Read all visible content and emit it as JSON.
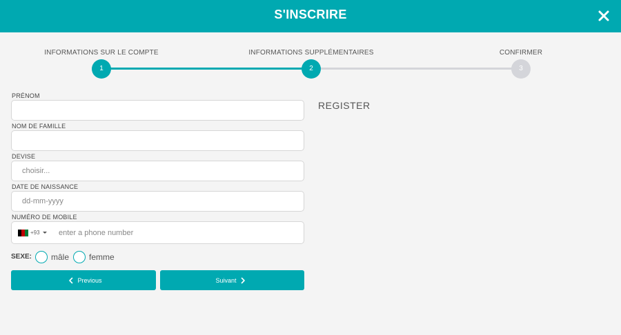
{
  "header": {
    "title": "S'INSCRIRE",
    "close_icon": "close-icon"
  },
  "stepper": {
    "steps": [
      {
        "label": "INFORMATIONS SUR LE COMPTE",
        "number": "1",
        "state": "active"
      },
      {
        "label": "INFORMATIONS SUPPLÉMENTAIRES",
        "number": "2",
        "state": "active"
      },
      {
        "label": "CONFIRMER",
        "number": "3",
        "state": "inactive"
      }
    ]
  },
  "form": {
    "prenom": {
      "label": "PRÉNOM",
      "value": "",
      "placeholder": ""
    },
    "nom": {
      "label": "NOM DE FAMILLE",
      "value": "",
      "placeholder": ""
    },
    "devise": {
      "label": "DEVISE",
      "value": "",
      "placeholder": "choisir..."
    },
    "naissance": {
      "label": "DATE DE NAISSANCE",
      "value": "",
      "placeholder": "dd-mm-yyyy"
    },
    "mobile": {
      "label": "NUMÉRO DE MOBILE",
      "dial_code": "+93",
      "flag": "afghanistan-flag-icon",
      "value": "",
      "placeholder": "enter a phone number"
    },
    "sexe": {
      "label": "SEXE:",
      "options": [
        "mâle",
        "femme"
      ]
    }
  },
  "buttons": {
    "previous": "Previous",
    "next": "Suivant"
  },
  "side": {
    "register": "REGISTER"
  },
  "colors": {
    "accent": "#00a9b1",
    "inactive_step": "#d4d5da",
    "background": "#f4f4f4"
  }
}
